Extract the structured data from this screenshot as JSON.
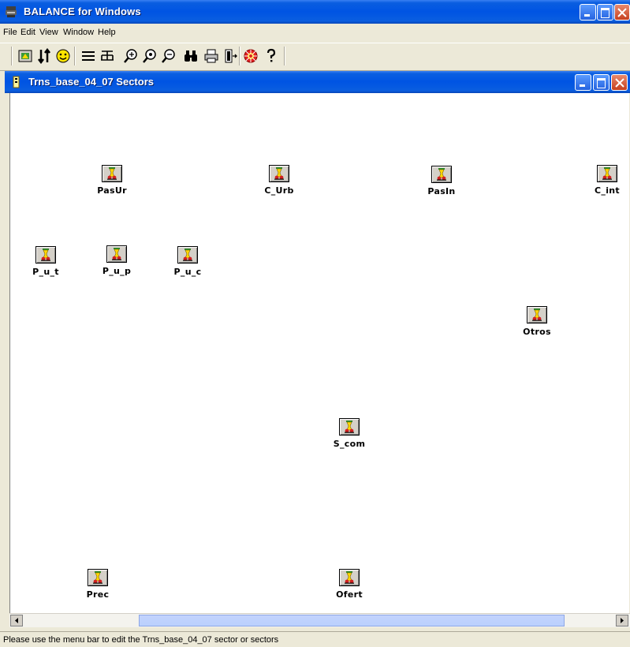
{
  "app": {
    "title": "BALANCE for Windows"
  },
  "menu": [
    "File",
    "Edit",
    "View",
    "Window",
    "Help"
  ],
  "toolbar": {
    "tools": [
      "new-sector-icon",
      "arrows-icon",
      "smiley-icon",
      "list-icon",
      "tree-icon",
      "zoom-in-icon",
      "zoom-fit-icon",
      "zoom-out-icon",
      "binoculars-icon",
      "print-icon",
      "exit-door-icon",
      "settings-wheel-icon",
      "help-icon"
    ]
  },
  "document": {
    "title": "Trns_base_04_07 Sectors"
  },
  "sectors": [
    {
      "label": "PasUr"
    },
    {
      "label": "C_Urb"
    },
    {
      "label": "PasIn"
    },
    {
      "label": "C_int"
    },
    {
      "label": "P_u_t"
    },
    {
      "label": "P_u_p"
    },
    {
      "label": "P_u_c"
    },
    {
      "label": "Otros"
    },
    {
      "label": "S_com"
    },
    {
      "label": "Prec"
    },
    {
      "label": "Ofert"
    }
  ],
  "status": {
    "text": "Please use the menu bar to edit the Trns_base_04_07 sector or sectors"
  },
  "colors": {
    "titlebar": "#0054e3",
    "canvas": "#ffffff",
    "chrome": "#ece9d8"
  }
}
